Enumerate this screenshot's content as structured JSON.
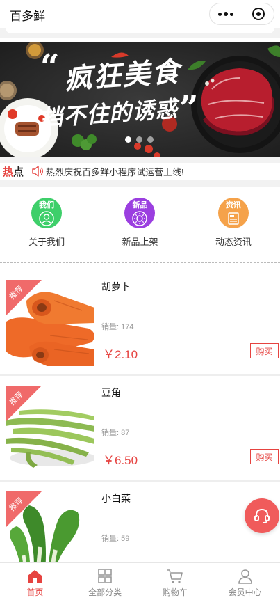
{
  "nav": {
    "title": "百多鲜"
  },
  "banner": {
    "line1": "疯狂美食",
    "line2": "挡不住的诱惑",
    "slides": 3,
    "active_slide": 1
  },
  "notice": {
    "tag_red": "热",
    "tag_black": "点",
    "text": "热烈庆祝百多鲜小程序试运营上线!"
  },
  "menu": [
    {
      "badge": "我们",
      "label": "关于我们",
      "color": "#3ecf6a",
      "icon": "user-icon"
    },
    {
      "badge": "新品",
      "label": "新品上架",
      "color": "#9b3fe0",
      "icon": "sun-icon"
    },
    {
      "badge": "资讯",
      "label": "动态资讯",
      "color": "#f5a24a",
      "icon": "news-icon"
    }
  ],
  "products": [
    {
      "ribbon": "推荐",
      "name": "胡萝卜",
      "sold_label": "销量:",
      "sold": "174",
      "price": "￥2.10",
      "buy": "购买",
      "image": "carrot"
    },
    {
      "ribbon": "推荐",
      "name": "豆角",
      "sold_label": "销量:",
      "sold": "87",
      "price": "￥6.50",
      "buy": "购买",
      "image": "beans"
    },
    {
      "ribbon": "推荐",
      "name": "小白菜",
      "sold_label": "销量:",
      "sold": "59",
      "price": "",
      "buy": "",
      "image": "bokchoy"
    }
  ],
  "tabs": [
    {
      "label": "首页",
      "icon": "home-icon",
      "active": true
    },
    {
      "label": "全部分类",
      "icon": "grid-icon",
      "active": false
    },
    {
      "label": "购物车",
      "icon": "cart-icon",
      "active": false
    },
    {
      "label": "会员中心",
      "icon": "person-icon",
      "active": false
    }
  ],
  "colors": {
    "accent": "#e64340",
    "ribbon": "#f06a6a"
  }
}
